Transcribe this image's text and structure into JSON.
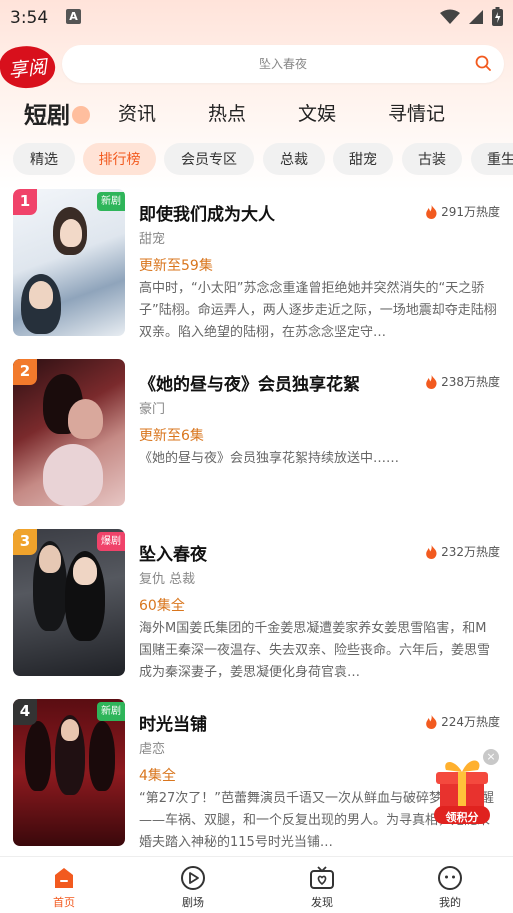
{
  "status_bar": {
    "time": "3:54",
    "a_icon": "A"
  },
  "header": {
    "logo_text": "享阅",
    "search_placeholder": "坠入春夜"
  },
  "tabs": [
    "短剧",
    "资讯",
    "热点",
    "文娱",
    "寻情记"
  ],
  "active_tab": "短剧",
  "chips": [
    "精选",
    "排行榜",
    "会员专区",
    "总裁",
    "甜宠",
    "古装",
    "重生"
  ],
  "active_chip": "排行榜",
  "items": [
    {
      "rank": "1",
      "badge": "新剧",
      "title": "即使我们成为大人",
      "heat": "291万热度",
      "genre": "甜宠",
      "episodes": "更新至59集",
      "desc": "高中时，“小太阳”苏念念重逢曾拒绝她并突然消失的“天之骄子”陆栩。命运弄人，两人逐步走近之际，一场地震却夺走陆栩双亲。陷入绝望的陆栩，在苏念念坚定守…"
    },
    {
      "rank": "2",
      "badge": "",
      "title": "《她的昼与夜》会员独享花絮",
      "heat": "238万热度",
      "genre": "豪门",
      "episodes": "更新至6集",
      "desc": "《她的昼与夜》会员独享花絮持续放送中……"
    },
    {
      "rank": "3",
      "badge": "爆剧",
      "title": "坠入春夜",
      "heat": "232万热度",
      "genre": "复仇 总裁",
      "episodes": "60集全",
      "desc": "海外M国姜氏集团的千金姜思凝遭姜家养女姜思雪陷害，和M国赌王秦深一夜温存、失去双亲、险些丧命。六年后，姜思雪成为秦深妻子，姜思凝便化身荷官袁…"
    },
    {
      "rank": "4",
      "badge": "新剧",
      "title": "时光当铺",
      "heat": "224万热度",
      "genre": "虐恋",
      "episodes": "4集全",
      "desc": "“第27次了！”芭蕾舞演员千语又一次从鲜血与破碎梦境中惊醒——车祸、双腿，和一个反复出现的男人。为寻真相，她随未婚夫踏入神秘的115号时光当铺…"
    }
  ],
  "float_widget": {
    "label": "领积分",
    "close": "×"
  },
  "bottom_nav": [
    "首页",
    "剧场",
    "发现",
    "我的"
  ],
  "active_nav": "首页",
  "colors": {
    "accent": "#f25a1f",
    "episode_orange": "#d9761e",
    "rank_1": "#f0436a",
    "rank_2": "#f27a2c",
    "rank_3": "#f0a32c",
    "rank_4": "#333333"
  }
}
